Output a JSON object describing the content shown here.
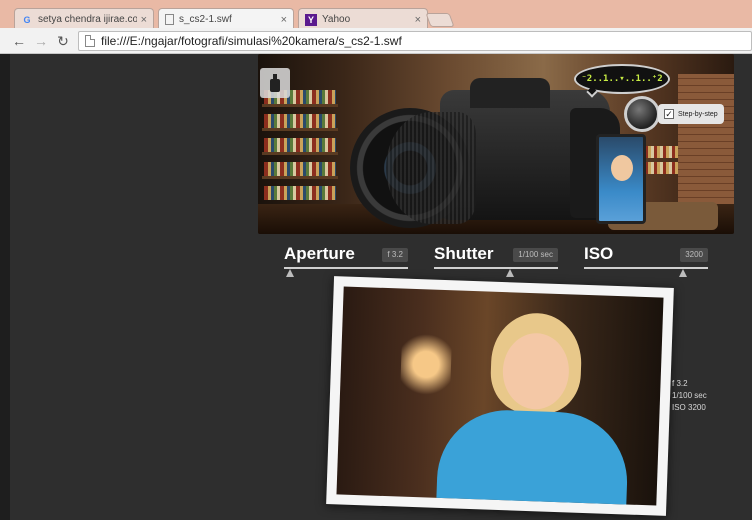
{
  "browser": {
    "tabs": [
      {
        "title": "setya chendra ijirae.com -",
        "favicon": "google-icon",
        "active": false
      },
      {
        "title": "s_cs2-1.swf",
        "favicon": "document-icon",
        "active": true
      },
      {
        "title": "Yahoo",
        "favicon": "yahoo-icon",
        "active": false
      }
    ],
    "close_glyph": "×",
    "url": "file:///E:/ngajar/fotografi/simulasi%20kamera/s_cs2-1.swf"
  },
  "sim": {
    "meter": "⁻2..1..▾..1..⁺2",
    "step_label": "Step-by-step",
    "step_checked": true,
    "controls": [
      {
        "name": "Aperture",
        "value": "f 3.2",
        "level": 0.02
      },
      {
        "name": "Shutter",
        "value": "1/100 sec",
        "level": 0.62
      },
      {
        "name": "ISO",
        "value": "3200",
        "level": 0.82
      }
    ],
    "exif": {
      "aperture": "f 3.2",
      "shutter": "1/100 sec",
      "iso": "ISO 3200"
    }
  }
}
